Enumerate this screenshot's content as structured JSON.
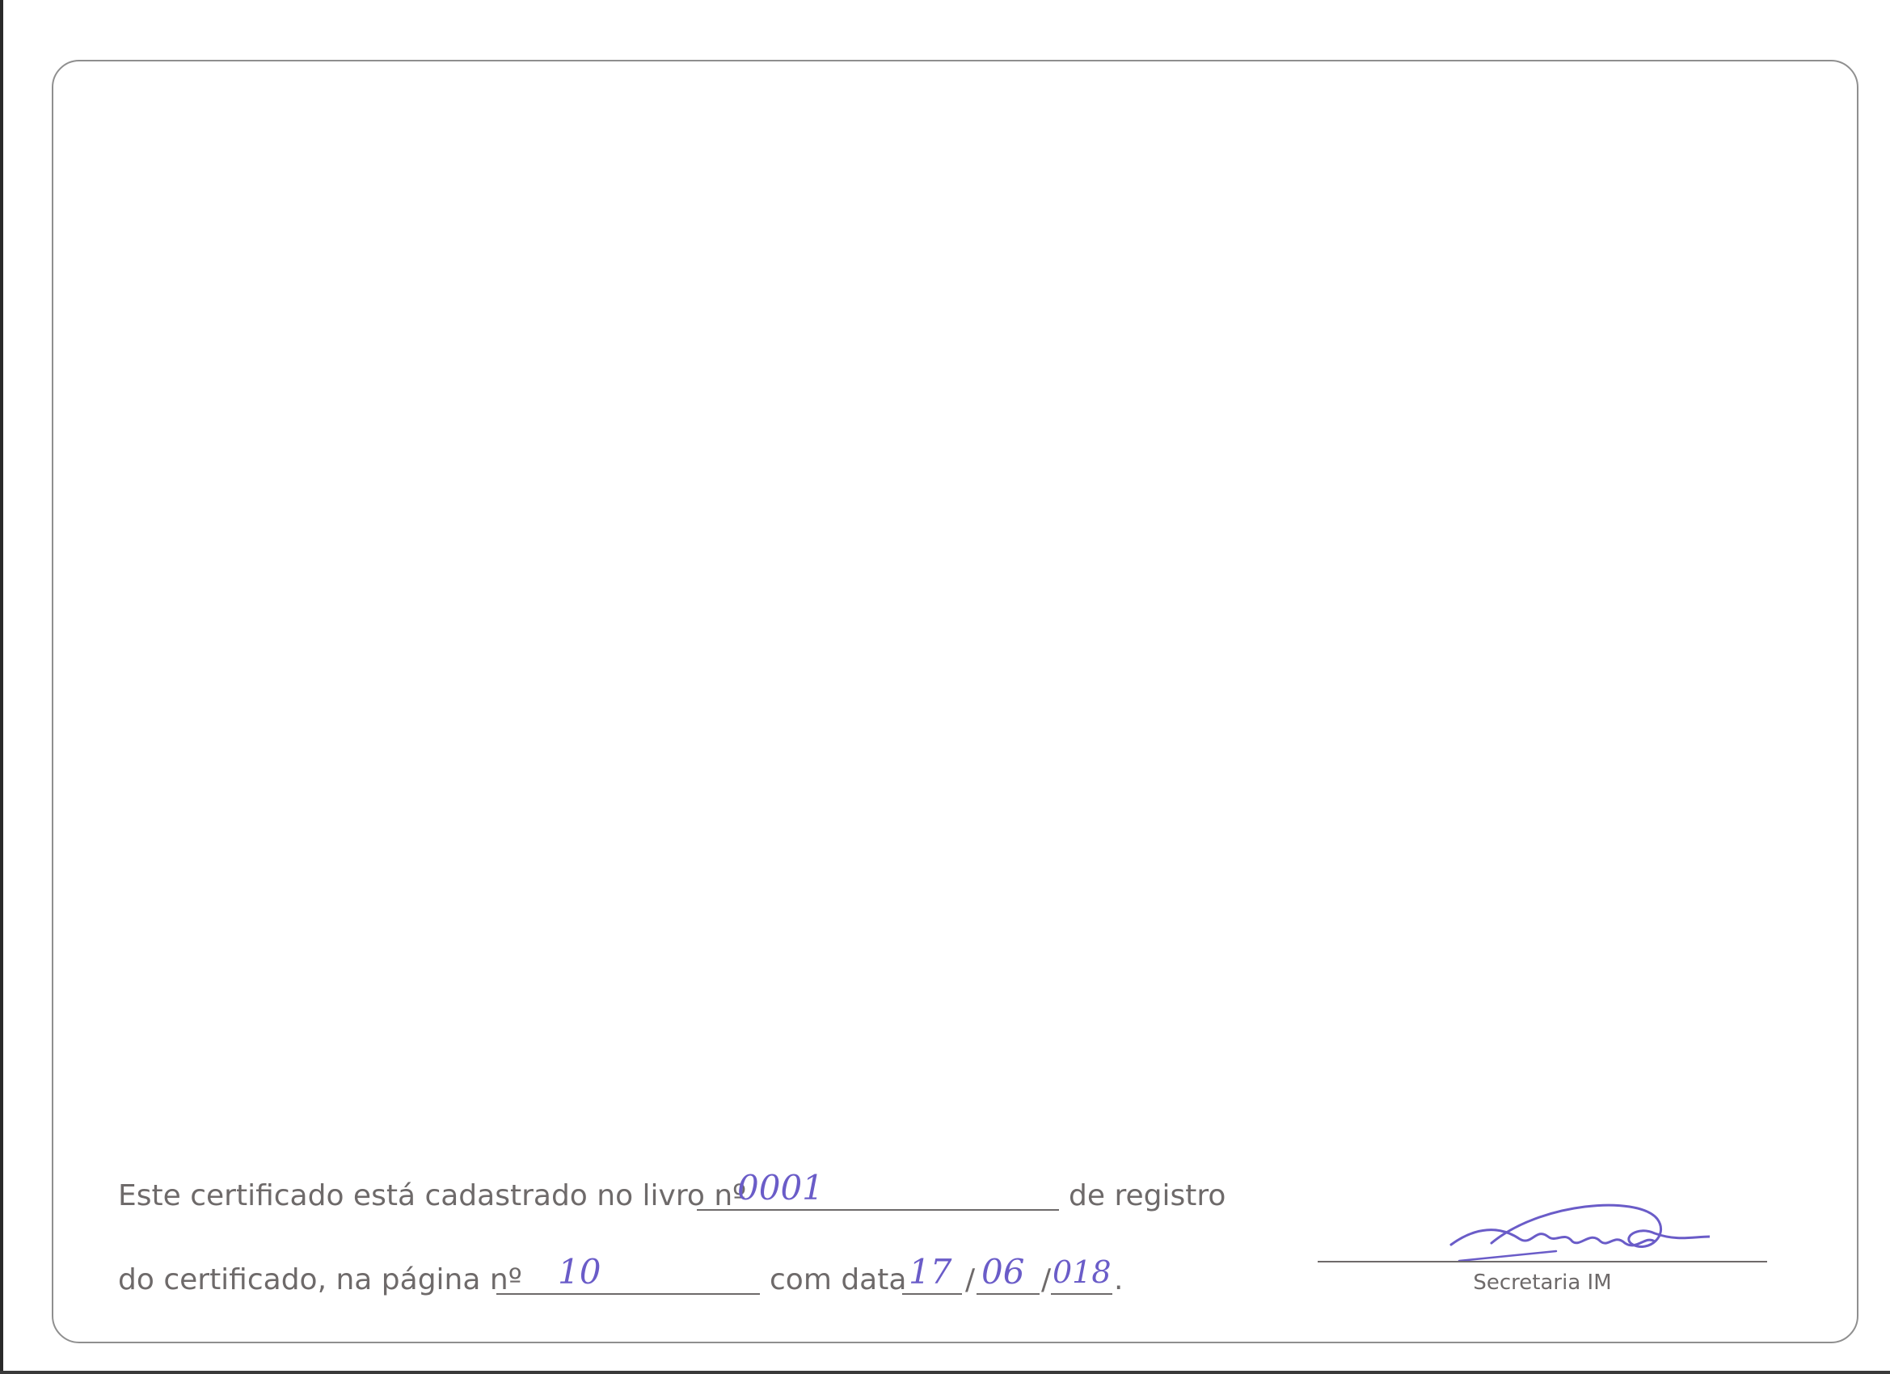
{
  "registro": {
    "line1_prefix": "Este certificado está cadastrado no livro nº",
    "livro_value": "0001",
    "line1_suffix": "de registro",
    "line2_prefix": "do certificado, na página nº",
    "pagina_value": "10",
    "line2_middle": "com data",
    "date_day": "17",
    "date_sep1": "/",
    "date_month": "06",
    "date_sep2": "/",
    "date_year": "018",
    "line2_end": "."
  },
  "signature": {
    "role_label": "Secretaria IM"
  },
  "colors": {
    "ink_handwriting": "#6a5cc8",
    "printed_text": "#6e6a6a",
    "frame": "#8f8f8f"
  }
}
